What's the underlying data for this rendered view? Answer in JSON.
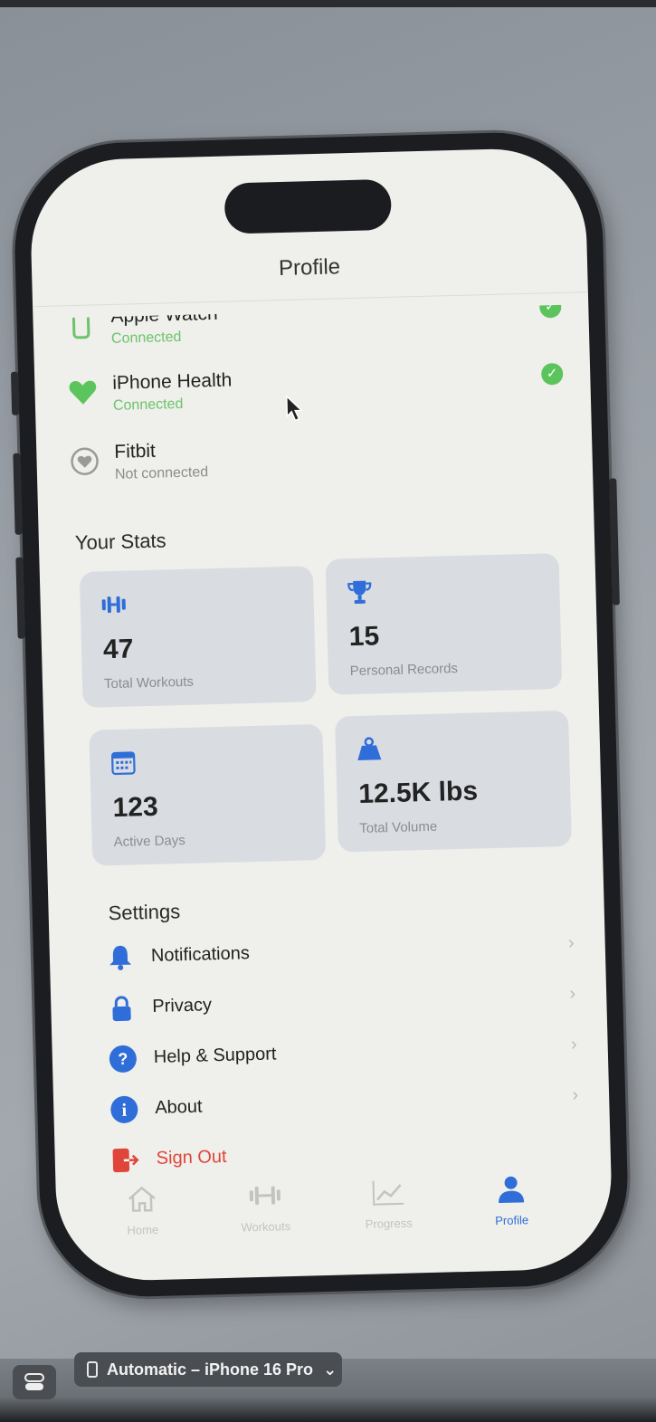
{
  "nav": {
    "title": "Profile"
  },
  "devices": [
    {
      "name": "Apple Watch",
      "status": "Connected",
      "connected": true,
      "icon": "watch-icon"
    },
    {
      "name": "iPhone Health",
      "status": "Connected",
      "connected": true,
      "icon": "heart-icon"
    },
    {
      "name": "Fitbit",
      "status": "Not connected",
      "connected": false,
      "icon": "heart-circle-icon"
    }
  ],
  "stats": {
    "title": "Your Stats",
    "cards": [
      {
        "value": "47",
        "label": "Total Workouts",
        "icon": "dumbbell-icon"
      },
      {
        "value": "15",
        "label": "Personal Records",
        "icon": "trophy-icon"
      },
      {
        "value": "123",
        "label": "Active Days",
        "icon": "calendar-icon"
      },
      {
        "value": "12.5K lbs",
        "label": "Total Volume",
        "icon": "weight-icon"
      }
    ]
  },
  "settings": {
    "title": "Settings",
    "items": [
      {
        "label": "Notifications",
        "icon": "bell-icon"
      },
      {
        "label": "Privacy",
        "icon": "lock-icon"
      },
      {
        "label": "Help & Support",
        "icon": "question-icon"
      },
      {
        "label": "About",
        "icon": "info-icon"
      }
    ],
    "sign_out": "Sign Out"
  },
  "tabs": [
    {
      "label": "Home",
      "icon": "house-icon",
      "active": false
    },
    {
      "label": "Workouts",
      "icon": "dumbbell-icon",
      "active": false
    },
    {
      "label": "Progress",
      "icon": "chart-icon",
      "active": false
    },
    {
      "label": "Profile",
      "icon": "person-icon",
      "active": true
    }
  ],
  "toolbar": {
    "device_selector": "Automatic – iPhone 16 Pro"
  },
  "colors": {
    "accent": "#2f6ed8",
    "connected": "#6cc46a",
    "danger": "#e0453a"
  }
}
